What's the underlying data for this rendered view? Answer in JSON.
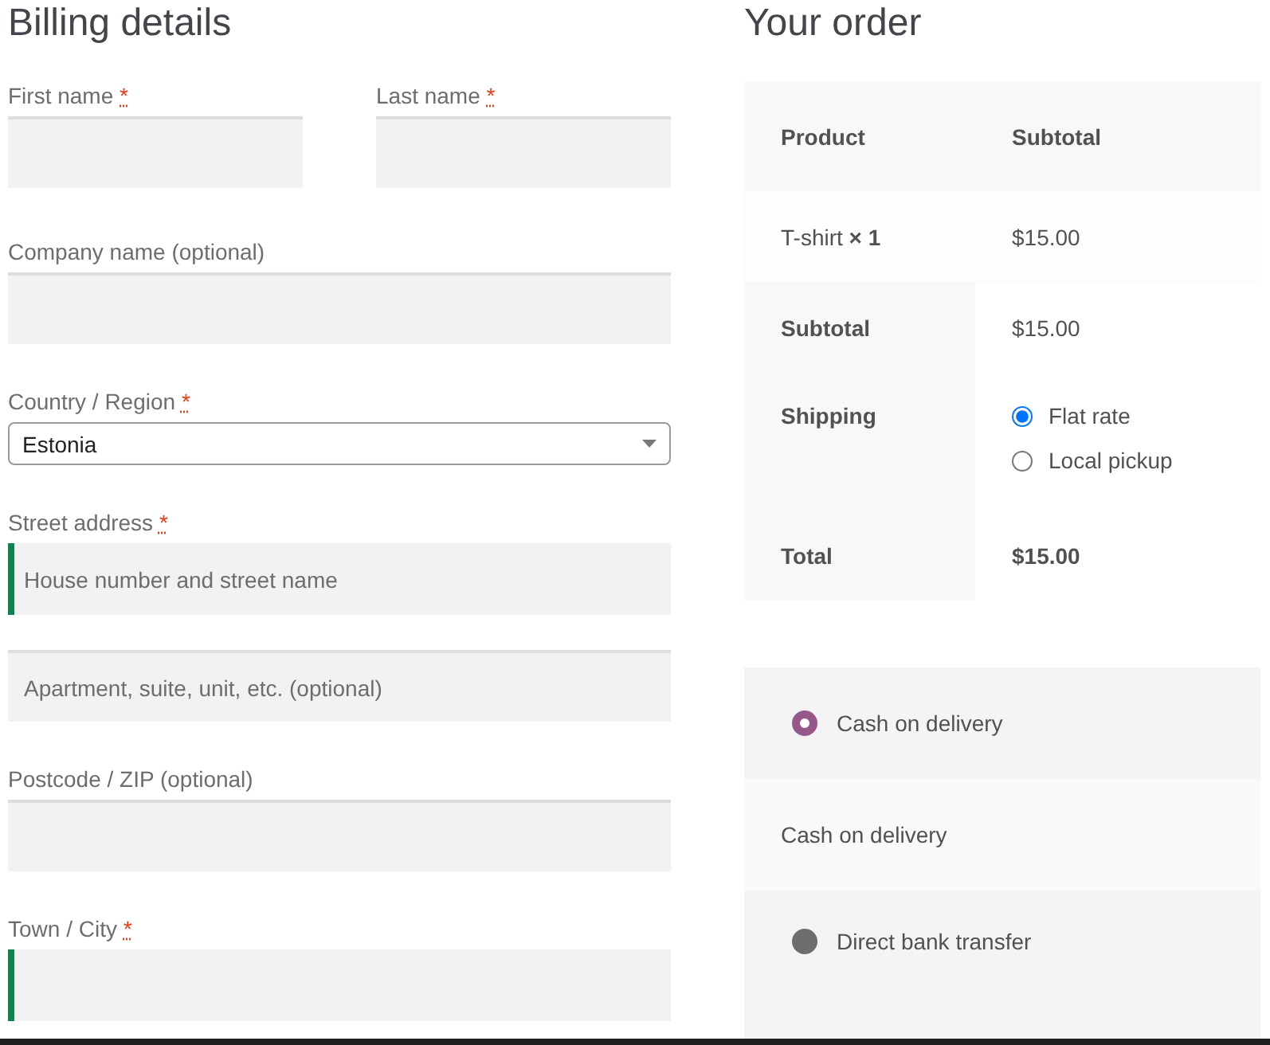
{
  "billing": {
    "title": "Billing details",
    "name_row": [
      {
        "label": "First name",
        "required_mark": "*",
        "focused": false
      },
      {
        "label": "Last name",
        "required_mark": "*",
        "focused": false
      }
    ],
    "fields": [
      {
        "kind": "text",
        "label": "Company name (optional)",
        "focused": false
      },
      {
        "kind": "select",
        "label": "Country / Region",
        "required_mark": "*",
        "value": "Estonia"
      },
      {
        "kind": "text",
        "label": "Street address",
        "required_mark": "*",
        "placeholder": "House number and street name",
        "focused": true
      },
      {
        "kind": "text",
        "placeholder": "Apartment, suite, unit, etc. (optional)",
        "focused": false
      },
      {
        "kind": "text",
        "label": "Postcode / ZIP (optional)",
        "focused": false
      },
      {
        "kind": "text",
        "label": "Town / City",
        "required_mark": "*",
        "focused": true
      }
    ]
  },
  "order": {
    "title": "Your order",
    "columns": [
      "Product",
      "Subtotal"
    ],
    "items": [
      {
        "name": "T-shirt",
        "quantity": "× 1",
        "subtotal": "$15.00"
      }
    ],
    "subtotal": {
      "label": "Subtotal",
      "value": "$15.00"
    },
    "shipping": {
      "label": "Shipping",
      "options": [
        {
          "label": "Flat rate",
          "selected": true
        },
        {
          "label": "Local pickup",
          "selected": false
        }
      ]
    },
    "total": {
      "label": "Total",
      "value": "$15.00"
    }
  },
  "payment": {
    "methods": [
      {
        "label": "Cash on delivery",
        "selected": true,
        "description": "Cash on delivery"
      },
      {
        "label": "Direct bank transfer",
        "selected": false
      }
    ]
  }
}
